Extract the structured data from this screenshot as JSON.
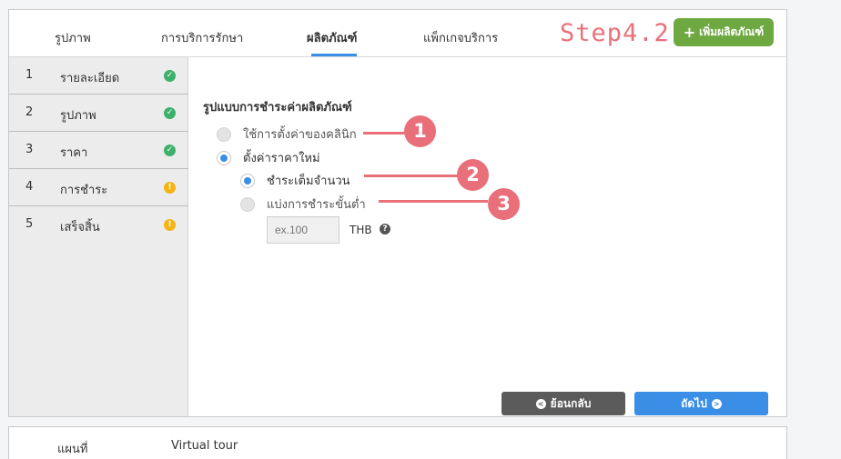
{
  "tabs": [
    {
      "label": "รูปภาพ",
      "active": false
    },
    {
      "label": "การบริการรักษา",
      "active": false
    },
    {
      "label": "ผลิตภัณฑ์",
      "active": true
    },
    {
      "label": "แพ็กเกจบริการ",
      "active": false
    }
  ],
  "step_label": "Step4.2",
  "add_button": {
    "icon": "plus-icon",
    "label": "เพิ่มผลิตภัณฑ์"
  },
  "sidebar": [
    {
      "num": "1",
      "label": "รายละเอียด",
      "status": "complete"
    },
    {
      "num": "2",
      "label": "รูปภาพ",
      "status": "complete"
    },
    {
      "num": "3",
      "label": "ราคา",
      "status": "complete"
    },
    {
      "num": "4",
      "label": "การชำระ",
      "status": "warning"
    },
    {
      "num": "5",
      "label": "เสร็จสิ้น",
      "status": "warning"
    }
  ],
  "section_title": "รูปแบบการชำระค่าผลิตภัณฑ์",
  "options": {
    "clinic_default": {
      "label": "ใช้การตั้งค่าของคลินิก",
      "checked": false
    },
    "new_price": {
      "label": "ตั้งค่าราคาใหม่",
      "checked": true
    },
    "full_payment": {
      "label": "ชำระเต็มจำนวน",
      "checked": true
    },
    "min_payment": {
      "label": "แบ่งการชำระขั้นต่ำ",
      "checked": false
    }
  },
  "amount_input": {
    "placeholder": "ex.100",
    "value": ""
  },
  "currency": "THB",
  "annotations": [
    "1",
    "2",
    "3"
  ],
  "colors": {
    "accent": "#3a8ee6",
    "success": "#3db06b",
    "warning": "#f3b414",
    "annotation": "#e9707a",
    "add_button": "#6ea840"
  },
  "buttons": {
    "back": "ย้อนกลับ",
    "next": "ถัดไป"
  },
  "secondary_tabs": [
    "แผนที่",
    "Virtual tour"
  ]
}
